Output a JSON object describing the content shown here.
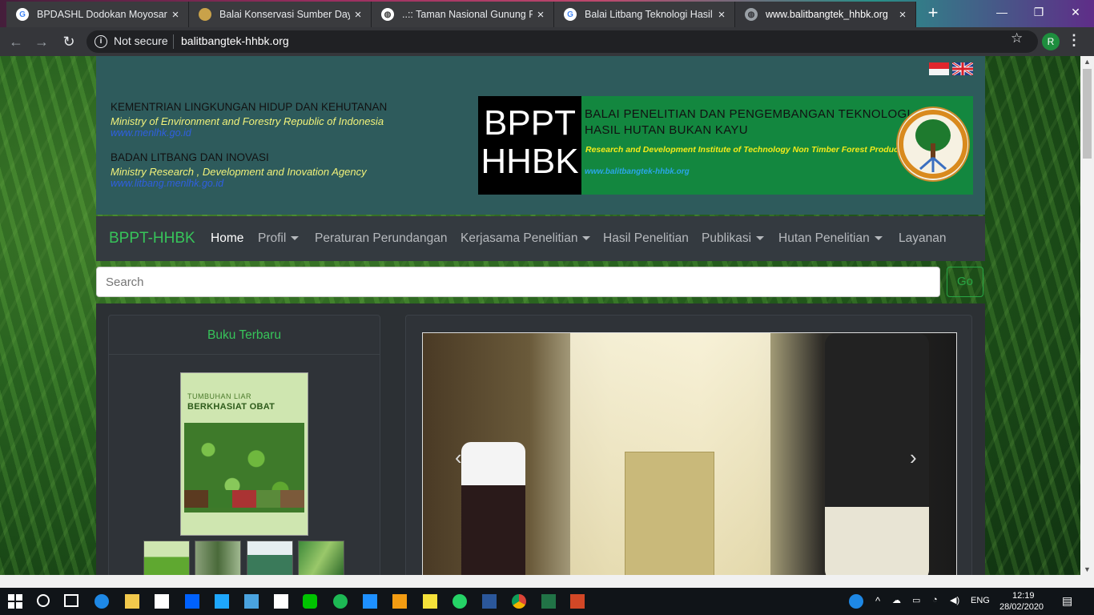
{
  "browser": {
    "tabs": [
      {
        "title": "BPDASHL Dodokan Moyosari - ",
        "favicon": "google-g",
        "close": "×"
      },
      {
        "title": "Balai Konservasi Sumber Daya",
        "favicon": "emblem-logo",
        "close": "×"
      },
      {
        "title": "..:: Taman Nasional Gunung Rin",
        "favicon": "globe-icon",
        "close": "×"
      },
      {
        "title": "Balai Litbang Teknologi Hasil H",
        "favicon": "google-g",
        "close": "×"
      },
      {
        "title": "www.balitbangtek_hhbk.org",
        "favicon": "globe-icon",
        "close": "×"
      }
    ],
    "new_tab": "+",
    "window_controls": {
      "minimize": "—",
      "restore": "❐",
      "close": "✕"
    },
    "nav": {
      "back": "←",
      "forward": "→",
      "reload": "↻"
    },
    "security": "Not secure",
    "url": "balitbangtek-hhbk.org",
    "star": "☆",
    "profile_initial": "R",
    "menu": "⋮"
  },
  "header": {
    "ministry": "KEMENTRIAN LINGKUNGAN HIDUP DAN KEHUTANAN",
    "ministry_en": "Ministry of Environment and Forestry Republic of Indonesia",
    "ministry_web": "www.menlhk.go.id",
    "agency": "BADAN LITBANG DAN INOVASI",
    "agency_en": "Ministry Research , Development and Inovation Agency",
    "agency_web": "www.litbang.menlhk.go.id",
    "banner": {
      "acronym_line1": "BPPT",
      "acronym_line2": "HHBK",
      "title_line1": "BALAI PENELITIAN DAN PENGEMBANGAN TEKNOLOGI",
      "title_line2": "HASIL HUTAN BUKAN KAYU",
      "english": "Research and Development Institute of Technology Non Timber Forest Product",
      "website": "www.balitbangtek-hhbk.org"
    },
    "languages": [
      "id-flag",
      "uk-flag"
    ]
  },
  "navbar": {
    "brand": "BPPT-HHBK",
    "items": [
      {
        "label": "Home",
        "dropdown": false,
        "active": true
      },
      {
        "label": "Profil",
        "dropdown": true,
        "active": false
      },
      {
        "label": "Peraturan Perundangan",
        "dropdown": false,
        "active": false
      },
      {
        "label": "Kerjasama Penelitian",
        "dropdown": true,
        "active": false
      },
      {
        "label": "Hasil Penelitian",
        "dropdown": false,
        "active": false
      },
      {
        "label": "Publikasi",
        "dropdown": true,
        "active": false
      },
      {
        "label": "Hutan Penelitian",
        "dropdown": true,
        "active": false
      },
      {
        "label": "Layanan",
        "dropdown": false,
        "active": false
      }
    ]
  },
  "search": {
    "placeholder": "Search",
    "button": "Go"
  },
  "sidebar": {
    "heading": "Buku Terbaru",
    "book": {
      "title_line1": "TUMBUHAN LIAR",
      "title_line2": "BERKHASIAT OBAT"
    }
  },
  "carousel": {
    "prev": "‹",
    "next": "›"
  },
  "taskbar": {
    "time": "12:19",
    "date": "28/02/2020",
    "language": "ENG"
  },
  "colors": {
    "header_bg": "#2e5b5c",
    "navbar_bg": "#343a40",
    "brand_green": "#37c45a",
    "banner_green": "#13873f"
  }
}
